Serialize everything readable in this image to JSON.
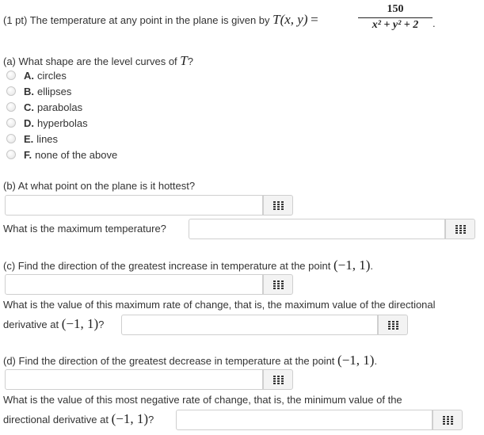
{
  "problem": {
    "intro": "(1 pt) The temperature at any point in the plane is given by",
    "func": "T(x, y)",
    "equals": "=",
    "numerator": "150",
    "denominator": "x² + y² + 2",
    "period": "."
  },
  "part_a": {
    "prompt": "(a) What shape are the level curves of",
    "var": "T",
    "qmark": "?",
    "options": [
      {
        "letter": "A.",
        "text": "circles"
      },
      {
        "letter": "B.",
        "text": "ellipses"
      },
      {
        "letter": "C.",
        "text": "parabolas"
      },
      {
        "letter": "D.",
        "text": "hyperbolas"
      },
      {
        "letter": "E.",
        "text": "lines"
      },
      {
        "letter": "F.",
        "text": "none of the above"
      }
    ]
  },
  "part_b": {
    "prompt": "(b) At what point on the plane is it hottest?",
    "answer_1": "",
    "max_temp_label": "What is the maximum temperature?",
    "answer_2": ""
  },
  "part_c": {
    "prompt": "(c) Find the direction of the greatest increase in temperature at the point",
    "point": "(−1, 1)",
    "period": ".",
    "answer_1": "",
    "rate_label_line1": "What is the value of this maximum rate of change, that is, the maximum value of the directional",
    "rate_label_line2": "derivative at",
    "rate_point": "(−1, 1)",
    "rate_qmark": "?",
    "answer_2": ""
  },
  "part_d": {
    "prompt": "(d) Find the direction of the greatest decrease in temperature at the point",
    "point": "(−1, 1)",
    "period": ".",
    "answer_1": "",
    "rate_label_line1": "What is the value of this most negative rate of change, that is, the minimum value of the",
    "rate_label_line2": "directional derivative at",
    "rate_point": "(−1, 1)",
    "rate_qmark": "?",
    "answer_2": ""
  },
  "icons": {
    "keypad": "equation-editor-icon"
  }
}
